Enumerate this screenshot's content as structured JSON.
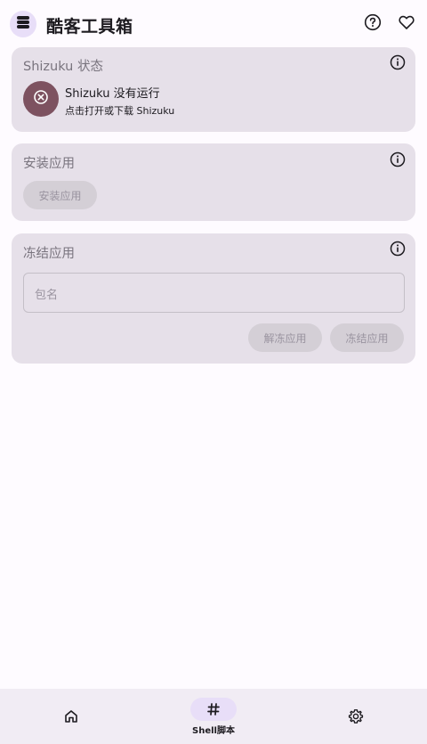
{
  "app": {
    "title": "酷客工具箱",
    "logo_icon": "stack-icon",
    "help_icon": "help-circle-icon",
    "favorite_icon": "heart-icon"
  },
  "shizuku_card": {
    "title": "Shizuku 状态",
    "status_text": "Shizuku 没有运行",
    "hint_text": "点击打开或下载 Shizuku",
    "status_icon": "close-circle-icon",
    "status_color": "#7d5260"
  },
  "install_card": {
    "title": "安装应用",
    "button_label": "安装应用"
  },
  "freeze_card": {
    "title": "冻结应用",
    "input_placeholder": "包名",
    "unfreeze_label": "解冻应用",
    "freeze_label": "冻结应用"
  },
  "bottom_nav": {
    "items": [
      {
        "icon": "home-icon",
        "label": ""
      },
      {
        "icon": "hash-icon",
        "label": "Shell脚本",
        "selected": true
      },
      {
        "icon": "gear-icon",
        "label": ""
      }
    ]
  },
  "colors": {
    "background": "#fefbff",
    "card": "#e6e0e9",
    "accent_container": "#e8def8",
    "disabled_button": "#d4cfd6"
  }
}
